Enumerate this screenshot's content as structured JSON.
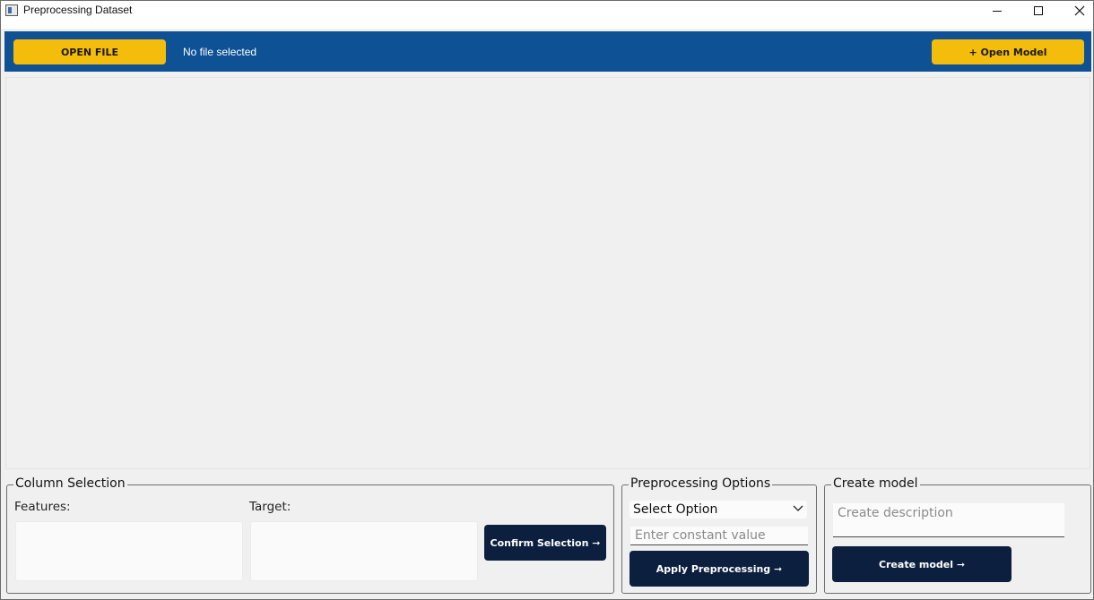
{
  "window": {
    "title": "Preprocessing Dataset",
    "icon": "app-window-icon",
    "controls": {
      "minimize": "minimize-icon",
      "maximize": "maximize-icon",
      "close": "close-icon"
    }
  },
  "toolbar": {
    "open_file_label": "OPEN FILE",
    "file_status": "No file selected",
    "open_model_label": "+ Open Model",
    "background_color": "#0e5195",
    "accent_color": "#f5bd0b"
  },
  "column_selection": {
    "title": "Column Selection",
    "features_label": "Features:",
    "target_label": "Target:",
    "confirm_label": "Confirm Selection ➞"
  },
  "preprocessing": {
    "title": "Preprocessing Options",
    "select_value": "Select Option",
    "constant_placeholder": "Enter constant value",
    "apply_label": "Apply Preprocessing ➞"
  },
  "create_model": {
    "title": "Create model",
    "description_placeholder": "Create description",
    "create_label": "Create model ➞",
    "button_color": "#0d1f3f"
  }
}
